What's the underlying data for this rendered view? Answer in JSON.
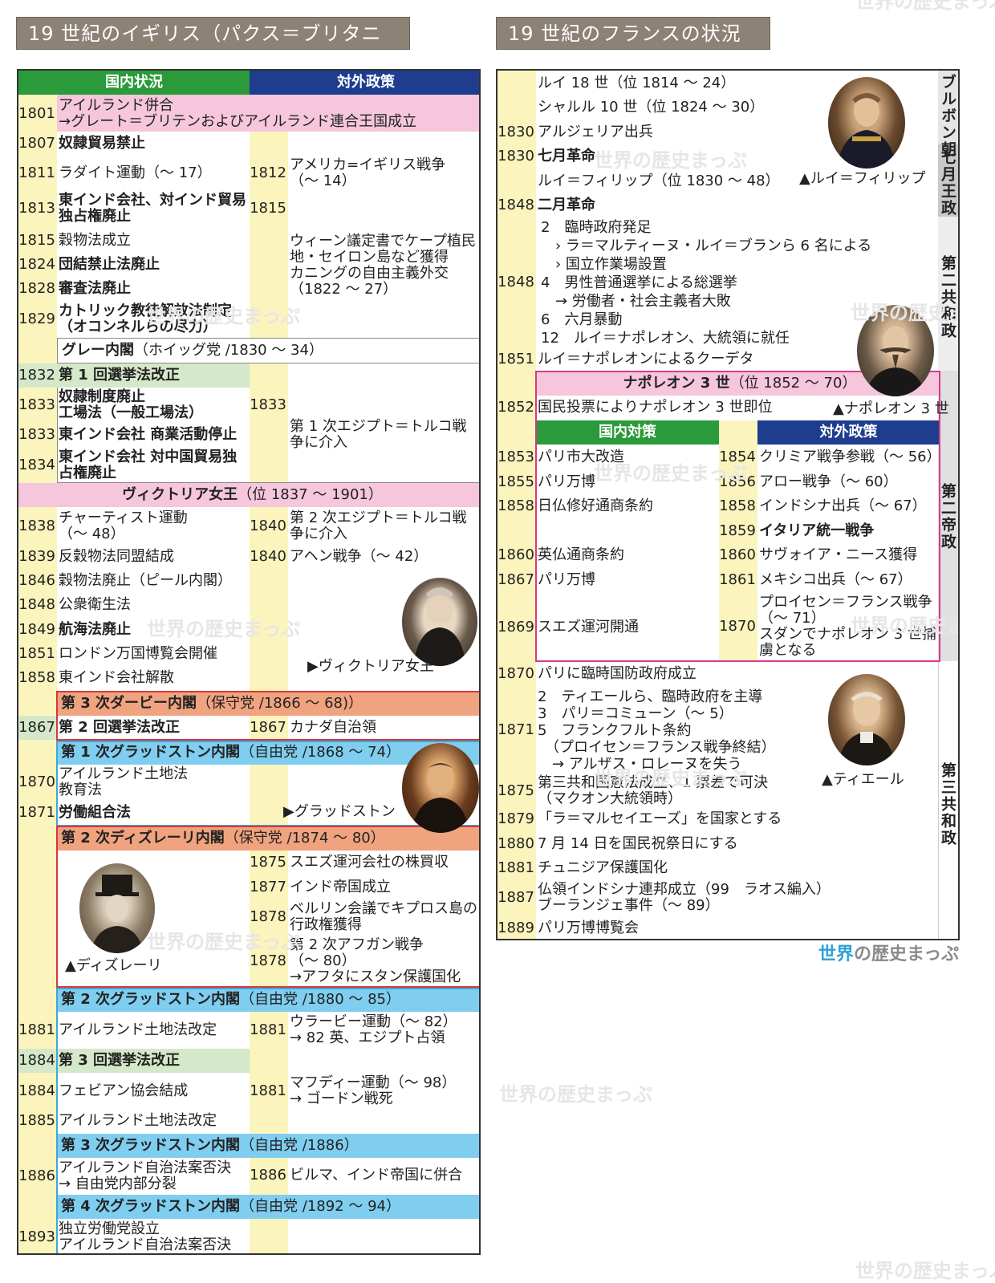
{
  "left_title": "19 世紀のイギリス（パクス＝ブリタニカ）",
  "right_title": "19 世紀のフランスの状況",
  "left_headers": {
    "domestic": "国内状況",
    "foreign": "対外政策"
  },
  "left_rows": [
    {
      "y": "1801",
      "t": "アイルランド併合\n→グレート＝ブリテンおよびアイルランド連合王国成立"
    },
    {
      "y": "1807",
      "t": "奴隷貿易禁止"
    },
    {
      "y": "1811",
      "t": "ラダイト運動（〜 17）"
    },
    {
      "y": "1813",
      "t": "東インド会社、対インド貿易独占権廃止"
    },
    {
      "y": "1815",
      "t": "穀物法成立"
    },
    {
      "y": "1824",
      "t": "団結禁止法廃止"
    },
    {
      "y": "1828",
      "t": "審査法廃止"
    },
    {
      "y": "1829",
      "t": "カトリック教徒解放法制定\n（オコンネルらの尽力）"
    },
    {
      "y": "1832",
      "t": "第 1 回選挙法改正"
    },
    {
      "y": "1833",
      "t": "奴隷制度廃止\n工場法（一般工場法）"
    },
    {
      "y": "1833",
      "t": "東インド会社 商業活動停止"
    },
    {
      "y": "1834",
      "t": "東インド会社 対中国貿易独占権廃止"
    },
    {
      "y": "1838",
      "t": "チャーティスト運動\n（〜 48）"
    },
    {
      "y": "1839",
      "t": "反穀物法同盟結成"
    },
    {
      "y": "1846",
      "t": "穀物法廃止（ピール内閣）"
    },
    {
      "y": "1848",
      "t": "公衆衛生法"
    },
    {
      "y": "1849",
      "t": "航海法廃止"
    },
    {
      "y": "1851",
      "t": "ロンドン万国博覧会開催"
    },
    {
      "y": "1858",
      "t": "東インド会社解散"
    },
    {
      "y": "1867",
      "t": "第 2 回選挙法改正"
    },
    {
      "y": "1870",
      "t": "アイルランド土地法\n教育法"
    },
    {
      "y": "1871",
      "t": "労働組合法"
    },
    {
      "y": "1881",
      "t": "アイルランド土地法改定"
    },
    {
      "y": "1884",
      "t": "第 3 回選挙法改正"
    },
    {
      "y": "1884",
      "t": "フェビアン協会結成"
    },
    {
      "y": "1885",
      "t": "アイルランド土地法改定"
    },
    {
      "y": "1886",
      "t": "アイルランド自治法案否決\n→ 自由党内部分裂"
    },
    {
      "y": "1893",
      "t": "独立労働党設立\nアイルランド自治法案否決"
    }
  ],
  "left_foreign": [
    {
      "y": "1812",
      "t": "アメリカ=イギリス戦争\n（〜 14）"
    },
    {
      "y": "1815",
      "t": ""
    },
    {
      "y": "",
      "t": "ウィーン議定書でケープ植民地・セイロン島など獲得\nカニングの自由主義外交\n（1822 〜 27）"
    },
    {
      "y": "1833",
      "t": ""
    },
    {
      "y": "",
      "t": "第 1 次エジプト＝トルコ戦争に介入"
    },
    {
      "y": "1840",
      "t": "第 2 次エジプト＝トルコ戦争に介入"
    },
    {
      "y": "1840",
      "t": "アヘン戦争（〜 42）"
    },
    {
      "y": "1867",
      "t": "カナダ自治領"
    },
    {
      "y": "1875",
      "t": "スエズ運河会社の株買収"
    },
    {
      "y": "1877",
      "t": "インド帝国成立"
    },
    {
      "y": "1878",
      "t": "ベルリン会議でキプロス島の行政権獲得"
    },
    {
      "y": "1878",
      "t": "第 2 次アフガン戦争\n（〜 80）\n→アフタにスタン保護国化"
    },
    {
      "y": "1881",
      "t": "ウラービー運動（〜 82）\n→ 82 英、エジプト占領"
    },
    {
      "y": "1881",
      "t": "マフディー運動（〜 98）\n→ ゴードン戦死"
    },
    {
      "y": "1886",
      "t": "ビルマ、インド帝国に併合"
    }
  ],
  "left_bands": {
    "grey": [
      "グレー内閣",
      "（ホイッグ党 /1830 〜 34）"
    ],
    "victoria": [
      "ヴィクトリア女王",
      "（位 1837 〜 1901）"
    ],
    "derby": [
      "第 3 次ダービー内閣",
      "（保守党 /1866 〜 68)）"
    ],
    "gladstone1": [
      "第 1 次グラッドストン内閣",
      "（自由党 /1868 〜 74）"
    ],
    "disraeli": [
      "第 2 次ディズレーリ内閣",
      "（保守党 /1874 〜 80）"
    ],
    "gladstone2": [
      "第 2 次グラッドストン内閣",
      "（自由党 /1880 〜 85）"
    ],
    "gladstone3": [
      "第 3 次グラッドストン内閣",
      "（自由党 /1886）"
    ],
    "gladstone4": [
      "第 4 次グラッドストン内閣",
      "（自由党 /1892 〜 94）"
    ]
  },
  "captions": {
    "victoria": "▶ヴィクトリア女王",
    "gladstone": "▶グラッドストン",
    "disraeli": "▲ディズレーリ",
    "louis_philippe": "▲ルイ＝フィリップ",
    "napoleon3": "▲ナポレオン 3 世",
    "thiers": "▲ティエール"
  },
  "right_rows": [
    {
      "y": "",
      "t": "ルイ 18 世（位 1814 〜 24）"
    },
    {
      "y": "",
      "t": "シャルル 10 世（位 1824 〜 30）"
    },
    {
      "y": "1830",
      "t": "アルジェリア出兵"
    },
    {
      "y": "1830",
      "t": "七月革命"
    },
    {
      "y": "",
      "t": "ルイ＝フィリップ（位 1830 〜 48）"
    },
    {
      "y": "1848",
      "t": "二月革命"
    },
    {
      "y": "1848",
      "t": "2　臨時政府発足\n　› ラ＝マルティーヌ・ルイ＝ブランら 6 名による\n　› 国立作業場設置\n4　男性普通選挙による総選挙\n　→ 労働者・社会主義者大敗\n6　六月暴動\n12　ルイ＝ナポレオン、大統領に就任"
    },
    {
      "y": "1851",
      "t": "ルイ＝ナポレオンによるクーデタ"
    },
    {
      "y": "1852",
      "t": "国民投票によりナポレオン 3 世即位"
    },
    {
      "y": "1870",
      "t": "パリに臨時国防政府成立"
    },
    {
      "y": "1871",
      "t": "2　ティエールら、臨時政府を主導\n3　パリ＝コミューン（〜 5）\n5　フランクフルト条約\n　（プロイセン＝フランス戦争終結）\n　→ アルザス・ロレーヌを失う"
    },
    {
      "y": "1875",
      "t": "第三共和国憲法成立、1 票差で可決\n（マクオン大統領時）"
    },
    {
      "y": "1879",
      "t": "「ラ＝マルセイエーズ」を国家とする"
    },
    {
      "y": "1880",
      "t": "7 月 14 日を国民祝祭日にする"
    },
    {
      "y": "1881",
      "t": "チュニジア保護国化"
    },
    {
      "y": "1887",
      "t": "仏領インドシナ連邦成立（99　ラオス編入）\nブーランジェ事件（〜 89）"
    },
    {
      "y": "1889",
      "t": "パリ万博博覧会"
    }
  ],
  "napoleon_band": [
    "ナポレオン 3 世",
    "（位 1852 〜 70）"
  ],
  "right_headers": {
    "domestic": "国内対策",
    "foreign": "対外政策"
  },
  "nap_domestic": [
    {
      "y": "1853",
      "t": "パリ市大改造"
    },
    {
      "y": "1855",
      "t": "パリ万博"
    },
    {
      "y": "1858",
      "t": "日仏修好通商条約"
    },
    {
      "y": "1860",
      "t": "英仏通商条約"
    },
    {
      "y": "1867",
      "t": "パリ万博"
    },
    {
      "y": "1869",
      "t": "スエズ運河開通"
    }
  ],
  "nap_foreign": [
    {
      "y": "1854",
      "t": "クリミア戦争参戦（〜 56）"
    },
    {
      "y": "1856",
      "t": "アロー戦争（〜 60）"
    },
    {
      "y": "1858",
      "t": "インドシナ出兵（〜 67）"
    },
    {
      "y": "1859",
      "t": "イタリア統一戦争"
    },
    {
      "y": "1860",
      "t": "サヴォイア・ニース獲得"
    },
    {
      "y": "1861",
      "t": "メキシコ出兵（〜 67）"
    },
    {
      "y": "1870",
      "t": "プロイセン＝フランス戦争\n（〜 71）\nスダンでナポレオン 3 世捕虜となる"
    }
  ],
  "regimes": [
    "ブルボン朝",
    "七月王政",
    "第二共和政",
    "第二帝政",
    "第三共和政"
  ],
  "watermark": "世界の歴史まっぷ",
  "logo": [
    "世界",
    "の歴史まっぷ"
  ],
  "colors": {
    "green": "#2a9a3a",
    "navy": "#1e3d8f",
    "pink": "#f5c6dc",
    "lightgreen": "#d5e8c9",
    "orange": "#f0a37f",
    "blue": "#7fcdef",
    "yellow": "#fbf4bd",
    "magenta": "#d63a8a",
    "red": "#d43a3a",
    "skyline": "#3ea7dd"
  }
}
